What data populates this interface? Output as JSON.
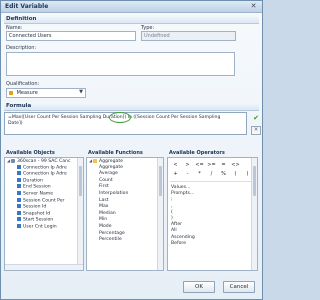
{
  "window": {
    "title": "Edit Variable"
  },
  "definition": {
    "section_title": "Definition",
    "name_label": "Name:",
    "name_value": "Connected Users",
    "type_label": "Type:",
    "type_value": "Undefined",
    "description_label": "Description:",
    "qualification_label": "Qualification:",
    "qualification_value": "Measure"
  },
  "formula": {
    "section_title": "Formula",
    "line1": "=Max([User Count Per Session Sampling Duration]) In ([Session Count Per Session Sampling",
    "line2": "Date])"
  },
  "available_objects": {
    "title": "Available Objects",
    "items": [
      {
        "label": "360scan - 99 SAC Canc",
        "kind": "univ",
        "depth": 0
      },
      {
        "label": "Connection Ip Adre",
        "kind": "dim",
        "depth": 1
      },
      {
        "label": "Connection Ip Adre",
        "kind": "dim",
        "depth": 1
      },
      {
        "label": "Duration",
        "kind": "dim",
        "depth": 1
      },
      {
        "label": "End Session",
        "kind": "dim",
        "depth": 1
      },
      {
        "label": "Server Name",
        "kind": "dim",
        "depth": 1
      },
      {
        "label": "Session Count Per",
        "kind": "dim",
        "depth": 1
      },
      {
        "label": "Session Id",
        "kind": "dim",
        "depth": 1
      },
      {
        "label": "Snapshot Id",
        "kind": "dim",
        "depth": 1
      },
      {
        "label": "Start Session",
        "kind": "dim",
        "depth": 1
      },
      {
        "label": "User Cnt Login",
        "kind": "dim",
        "depth": 1
      }
    ]
  },
  "available_functions": {
    "title": "Available Functions",
    "items": [
      {
        "label": "Aggregate",
        "kind": "folder",
        "depth": 0
      },
      {
        "label": "Aggregate",
        "depth": 1
      },
      {
        "label": "Average",
        "depth": 1
      },
      {
        "label": "Count",
        "depth": 1
      },
      {
        "label": "First",
        "depth": 1
      },
      {
        "label": "Interpolation",
        "depth": 1
      },
      {
        "label": "Last",
        "depth": 1
      },
      {
        "label": "Max",
        "depth": 1
      },
      {
        "label": "Median",
        "depth": 1
      },
      {
        "label": "Min",
        "depth": 1
      },
      {
        "label": "Mode",
        "depth": 1
      },
      {
        "label": "Percentage",
        "depth": 1
      },
      {
        "label": "Percentile",
        "depth": 1
      }
    ]
  },
  "available_operators": {
    "title": "Available Operators",
    "symbols_row1": [
      "<",
      ">",
      "<=",
      ">=",
      "=",
      "<>"
    ],
    "symbols_row2": [
      "+",
      "-",
      "*",
      "/",
      "%",
      "(",
      ")"
    ],
    "list": [
      "Values...",
      "Prompts...",
      ";",
      ",",
      "(",
      ")",
      "After",
      "All",
      "Ascending",
      "Before"
    ]
  },
  "buttons": {
    "ok": "OK",
    "cancel": "Cancel"
  },
  "colors": {
    "accent_green": "#42a23d",
    "title_blue": "#1f3550"
  }
}
